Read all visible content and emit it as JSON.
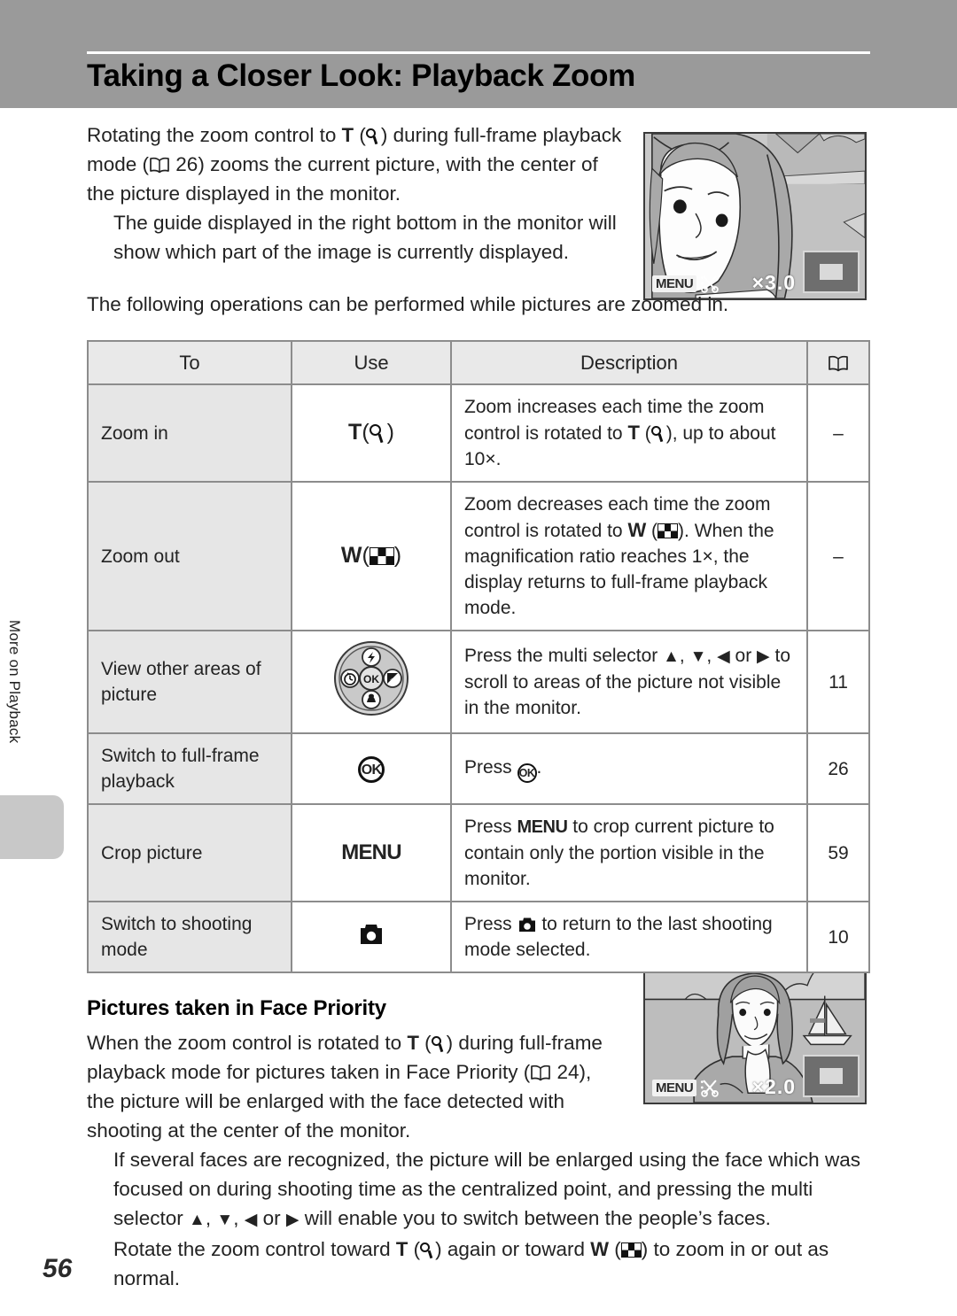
{
  "header": {
    "title": "Taking a Closer Look: Playback Zoom",
    "band_color": "#9a9a9a"
  },
  "side_tab": {
    "label": "More on Playback"
  },
  "intro": {
    "p1_a": "Rotating the zoom control to ",
    "p1_T": "T",
    "p1_b": ") during full-frame playback mode (",
    "p1_ref": "26",
    "p1_c": ") zooms the current picture, with the center of the picture displayed in the monitor.",
    "p2": "The guide displayed in the right bottom in the monitor will show which part of the image is currently displayed.",
    "p3": "The following operations can be performed while pictures are zoomed in."
  },
  "table": {
    "headers": {
      "to": "To",
      "use": "Use",
      "description": "Description",
      "ref": "book-icon"
    },
    "rows": [
      {
        "to": "Zoom in",
        "use_label": "T",
        "use_icon": "magnifier-icon",
        "desc_a": "Zoom increases each time the zoom control is rotated to ",
        "desc_T": "T",
        "desc_b": "), up to about 10×.",
        "ref": "–"
      },
      {
        "to": "Zoom out",
        "use_label": "W",
        "use_icon": "thumbnail-grid-icon",
        "desc_a": "Zoom decreases each time the zoom control is rotated to ",
        "desc_W": "W",
        "desc_b": "). When the magnification ratio reaches 1×, the display returns to full-frame playback mode.",
        "ref": "–"
      },
      {
        "to": "View other areas of picture",
        "use_icon": "multi-selector-dial-icon",
        "desc_a": "Press the multi selector ",
        "desc_b": " to scroll to areas of the picture not visible in the monitor.",
        "ref": "11"
      },
      {
        "to": "Switch to full-frame playback",
        "use_icon": "ok-button-icon",
        "desc_a": "Press ",
        "desc_b": ".",
        "ref": "26"
      },
      {
        "to": "Crop picture",
        "use_label": "MENU",
        "desc_a": "Press ",
        "desc_menu": "MENU",
        "desc_b": " to crop current picture to contain only the portion visible in the monitor.",
        "ref": "59"
      },
      {
        "to": "Switch to shooting mode",
        "use_icon": "camera-icon",
        "desc_a": "Press ",
        "desc_b": " to return to the last shooting mode selected.",
        "ref": "10"
      }
    ]
  },
  "face_priority": {
    "title": "Pictures taken in Face Priority",
    "p1_a": "When the zoom control is rotated to ",
    "p1_T": "T",
    "p1_b": ") during full-frame playback mode for pictures taken in Face Priority (",
    "p1_ref": "24",
    "p1_c": "), the picture will be enlarged with the face detected with shooting at the center of the monitor.",
    "p2_a": "If several faces are recognized, the picture will be enlarged using the face which was focused on during shooting time as the centralized point, and pressing the multi selector ",
    "p2_b": " will enable you to switch between the people’s faces.",
    "p3_a": "Rotate the zoom control toward ",
    "p3_T": "T",
    "p3_b": ") again or toward ",
    "p3_W": "W",
    "p3_c": ") to zoom in or out as normal."
  },
  "monitor_top": {
    "menu_label": "MENU",
    "crop_icon": "scissors-icon",
    "zoom_label": "×3.0",
    "guide_icon": "zoom-guide-box"
  },
  "monitor_bottom": {
    "menu_label": "MENU",
    "crop_icon": "scissors-icon",
    "zoom_label": "×2.0",
    "guide_icon": "zoom-guide-box"
  },
  "footer": {
    "page_number": "56"
  }
}
